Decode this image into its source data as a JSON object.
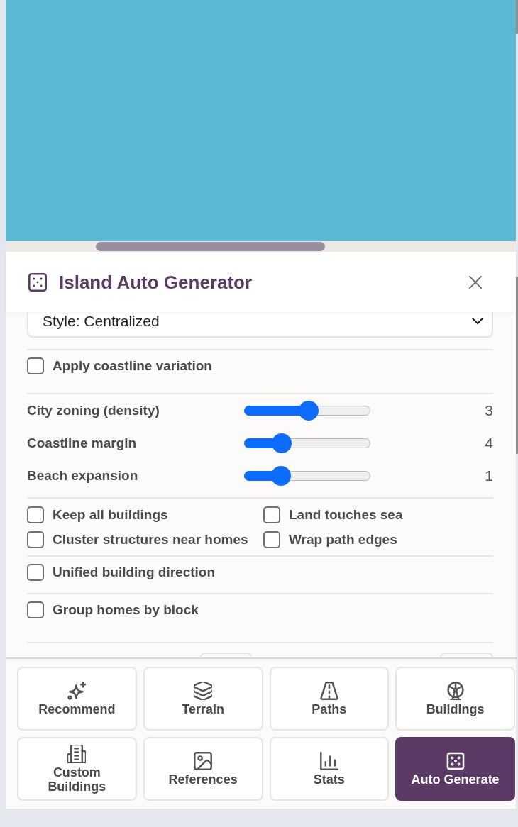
{
  "panel": {
    "title": "Island Auto Generator"
  },
  "sections": [
    {
      "kind": "select",
      "value": "Style: Centralized"
    },
    {
      "kind": "checkbox_list",
      "items": [
        {
          "label": "Apply coastline variation",
          "checked": false
        }
      ]
    },
    {
      "kind": "sliders",
      "items": [
        {
          "label": "City zoning (density)",
          "level": 0.51,
          "reading": "3"
        },
        {
          "label": "Coastline margin",
          "level": 0.3,
          "reading": "4"
        },
        {
          "label": "Beach expansion",
          "level": 0.29,
          "reading": "1"
        }
      ]
    },
    {
      "kind": "checkbox_grid",
      "items": [
        {
          "label": "Keep all buildings",
          "checked": false
        },
        {
          "label": "Land touches sea",
          "checked": false
        },
        {
          "label": "Cluster structures near homes",
          "checked": false
        },
        {
          "label": "Wrap path edges",
          "checked": false
        }
      ]
    },
    {
      "kind": "checkbox_list",
      "items": [
        {
          "label": "Unified building direction",
          "checked": false
        }
      ]
    },
    {
      "kind": "checkbox_list",
      "items": [
        {
          "label": "Group homes by block",
          "checked": false
        }
      ]
    }
  ],
  "nav": [
    {
      "label": "Recommend",
      "selected": false
    },
    {
      "label": "Terrain",
      "selected": false
    },
    {
      "label": "Paths",
      "selected": false
    },
    {
      "label": "Buildings",
      "selected": false
    },
    {
      "label": "Custom Buildings",
      "selected": false
    },
    {
      "label": "References",
      "selected": false
    },
    {
      "label": "Stats",
      "selected": false
    },
    {
      "label": "Auto Generate",
      "selected": true
    }
  ]
}
